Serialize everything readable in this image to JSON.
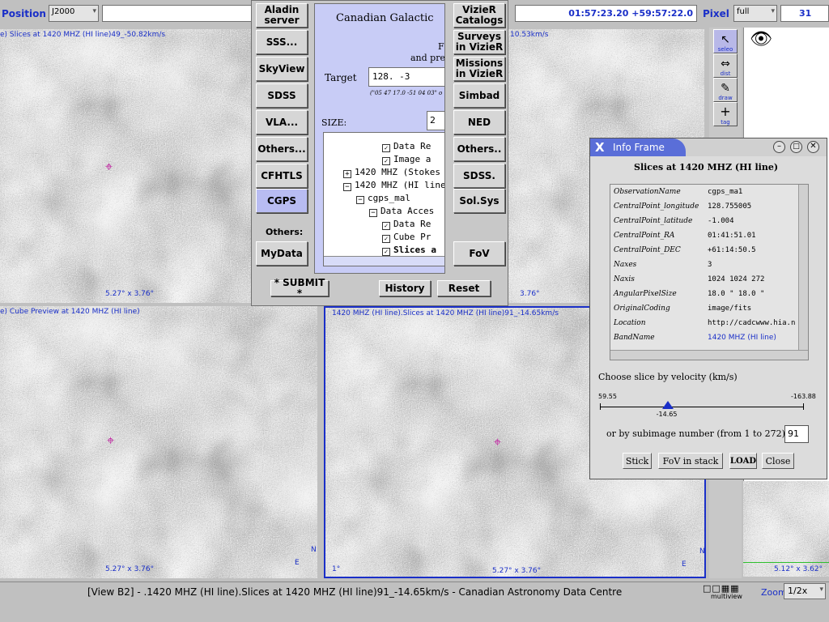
{
  "topbar": {
    "position_label": "Position",
    "frame_value": "J2000",
    "coords": "01:57:23.20 +59:57:22.0",
    "pixel_label": "Pixel",
    "pixel_value": "full",
    "pixel_num": "31"
  },
  "views": {
    "tl_label": "e) Slices at 1420 MHZ (HI line)49_-50.82km/s",
    "tl_size": "5.27° x 3.76°",
    "tr_label": "10.53km/s",
    "tr_size": "3.76°",
    "bl_label": "e) Cube Preview at 1420 MHZ (HI line)",
    "bl_size": "5.27° x 3.76°",
    "br_label": "1420 MHZ (HI line).Slices at 1420 MHZ (HI line)91_-14.65km/s",
    "br_size": "5.27° x 3.76°",
    "br_scale": "1°",
    "orient_n": "N",
    "orient_e": "E",
    "mini_size": "5.12° x 3.62°"
  },
  "server": {
    "left_buttons": [
      "Aladin\nserver",
      "SSS...",
      "SkyView",
      "SDSS",
      "VLA...",
      "Others...",
      "CFHTLS",
      "CGPS"
    ],
    "others_label": "Others:",
    "mydata": "MyData",
    "right_buttons": [
      "VizieR\nCatalogs",
      "Surveys\nin VizieR",
      "Missions\nin VizieR",
      "Simbad",
      "NED",
      "Others..",
      "SDSS.",
      "Sol.Sys"
    ],
    "fov": "FoV",
    "panel_title": "Canadian Galactic",
    "desc_1": "F",
    "desc_2": "and pre",
    "target_label": "Target",
    "target_value": "128. -3",
    "target_hint": "(\"05 47 17.0 -51 04 03\" o",
    "size_label": "SIZE:",
    "size_value": "2",
    "tree": [
      {
        "type": "cb",
        "indent": 68,
        "text": "Data Re"
      },
      {
        "type": "cb",
        "indent": 68,
        "text": "Image a"
      },
      {
        "type": "plus",
        "indent": 20,
        "text": "1420 MHZ (Stokes"
      },
      {
        "type": "minus",
        "indent": 20,
        "text": "1420 MHZ (HI line"
      },
      {
        "type": "minus",
        "indent": 36,
        "text": "cgps_mal"
      },
      {
        "type": "minus",
        "indent": 52,
        "text": "Data Acces"
      },
      {
        "type": "cb",
        "indent": 68,
        "text": "Data Re"
      },
      {
        "type": "cb",
        "indent": 68,
        "text": "Cube Pr"
      },
      {
        "type": "cb",
        "indent": 68,
        "text": "Slices a"
      }
    ],
    "submit": "* SUBMIT *",
    "history": "History",
    "reset": "Reset"
  },
  "tools": [
    "seleo",
    "dist",
    "draw",
    "tag"
  ],
  "info_frame": {
    "title": "Info Frame",
    "heading": "Slices at 1420 MHZ (HI line)",
    "rows": [
      {
        "k": "ObservationName",
        "v": "cgps_ma1"
      },
      {
        "k": "CentralPoint_longitude",
        "v": "128.755005"
      },
      {
        "k": "CentralPoint_latitude",
        "v": "-1.004"
      },
      {
        "k": "CentralPoint_RA",
        "v": "01:41:51.01"
      },
      {
        "k": "CentralPoint_DEC",
        "v": "+61:14:50.5"
      },
      {
        "k": "Naxes",
        "v": "3"
      },
      {
        "k": "Naxis",
        "v": "1024 1024 272"
      },
      {
        "k": "AngularPixelSize",
        "v": "18.0 \"  18.0 \""
      },
      {
        "k": "OriginalCoding",
        "v": "image/fits"
      },
      {
        "k": "Location",
        "v": "http://cadcwww.hia.n"
      },
      {
        "k": "BandName",
        "v": "1420 MHZ (HI line)"
      }
    ],
    "choose_label": "Choose slice by velocity (km/s)",
    "vel_min": "59.55",
    "vel_max": "-163.88",
    "vel_current": "-14.65",
    "vel_fraction": 0.332,
    "subimage_label": "or by subimage number (from 1 to 272):",
    "subimage_value": "91",
    "buttons": [
      "Stick",
      "FoV in stack",
      "LOAD",
      "Close"
    ]
  },
  "status": {
    "text": "[View B2] - .1420 MHZ (HI line).Slices at 1420 MHZ (HI line)91_-14.65km/s - Canadian Astronomy Data Centre",
    "multiview": "multiview",
    "zoom_label": "Zoom",
    "zoom_value": "1/2x"
  }
}
